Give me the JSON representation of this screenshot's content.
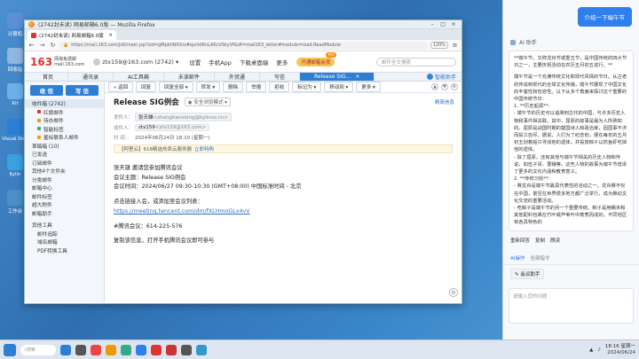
{
  "desktop": {
    "icons": [
      {
        "label": "计算机",
        "color": "#5b8fd8"
      },
      {
        "label": "回收站",
        "color": "#8fb5e0"
      },
      {
        "label": "Kit",
        "color": "#6cb0e8"
      },
      {
        "label": "Visual Studio",
        "color": "#2a7fd4"
      },
      {
        "label": "Kylin",
        "color": "#3aa0e0"
      },
      {
        "label": "工作台",
        "color": "#4a8fc8"
      }
    ]
  },
  "browser": {
    "window_title": "(2742封未读) 网易邮箱6.0版 — Mozilla Firefox",
    "tab_title": "(2742封未读) 网易邮箱6.0版",
    "url": "https://mail.163.com/js6/main.jsp?sid=gMpkhNIOns#qurtdRnLAKcVSkyVf&df=mail163_letter#module=read.ReadModule",
    "zoom": "120%"
  },
  "mail_header": {
    "logo_number": "163",
    "logo_brand": "网易免费邮",
    "logo_domain": "mail.163.com",
    "account": "ztx159@163.com (2742)",
    "links": [
      "设置",
      "手机App",
      "下载桌面端",
      "更多"
    ],
    "vip_label": "开通邮箱会员",
    "vip_badge": "特价",
    "search_placeholder": "邮件全文搜索"
  },
  "mail_tabs": {
    "items": [
      "首页",
      "通讯录",
      "AI工具箱",
      "未读邮件",
      "外贸通",
      "写信"
    ],
    "active": "Release SIG...",
    "helper": "智能助手"
  },
  "sidebar": {
    "receive": "收 信",
    "compose": "写 信",
    "items": [
      {
        "label": "收件箱 (2742)",
        "color": ""
      },
      {
        "label": "红旗邮件",
        "color": "#d33"
      },
      {
        "label": "待办邮件",
        "color": "#e90"
      },
      {
        "label": "智能标签",
        "color": "#3a8"
      },
      {
        "label": "星标联系人邮件",
        "color": "#f90"
      },
      {
        "label": "草稿箱 (10)",
        "color": ""
      },
      {
        "label": "已发送",
        "color": ""
      },
      {
        "label": "订阅邮件",
        "color": ""
      },
      {
        "label": "其他4个文件夹",
        "color": ""
      },
      {
        "label": "分类邮件",
        "color": ""
      },
      {
        "label": "邮箱中心",
        "color": ""
      },
      {
        "label": "邮件标签",
        "color": ""
      },
      {
        "label": "超大附件",
        "color": ""
      },
      {
        "label": "邮箱助手",
        "color": ""
      }
    ],
    "other_tools": "其他工具",
    "tools": [
      "邮件追踪",
      "域名邮箱",
      "PDF转换工具"
    ]
  },
  "toolbar": {
    "back": "« 返回",
    "buttons": [
      "回复",
      "回复全部 ▾",
      "转发 ▾",
      "删除",
      "举报",
      "拒收",
      "标记为 ▾",
      "移动到 ▾",
      "更多 ▾"
    ]
  },
  "email": {
    "subject": "Release SIG例会",
    "safe_mode": "安全浏览模式",
    "summary": "精简信息",
    "from_label": "发件人：",
    "from_name": "张天雄",
    "from_addr": "<zhangtianxiong@kylinos.cn>",
    "to_label": "收件人：",
    "to_name": "ztx159",
    "to_addr": "<ztx159@163.com>",
    "time_label": "时 间：",
    "time": "2024年06月24日 18:10 (星期一)",
    "notice": "【阿里云】618精选热卖云服务器",
    "notice_link": "立即特购",
    "body": {
      "line1": "张天雄 邀请您参加腾讯会议",
      "line2": "会议主题：Release SIG例会",
      "line3": "会议时间：2024/06/27 09:30-10:30 (GMT+08:00) 中国标准时间 - 北京",
      "line4": "点击链接入会，或添加至会议列表：",
      "link": "https://meeting.tencent.com/dm/fXLHmoGLx4vV",
      "line5": "#腾讯会议：614-225-576",
      "line6": "复制该信息，打开手机腾讯会议即可参与"
    }
  },
  "ai_panel": {
    "user_prompt": "介绍一下端午节",
    "assistant_name": "AI 助手",
    "paragraphs": [
      "**端午节，又称龙舟节或重五节，是中国传统的四大节日之一，主要庆祝活动在农历五月初五进行。**",
      "端午节是一个充满传统文化和现代风情的节日。从古老的传说到现代的全球文化传播，端午节展现了中国文化的丰富性和包容性。以下从多个角度来探讨这个重要的中国传统节日：",
      "1. **历史起源**：",
      "- 端午节的历史可以追溯到古代的中国，与许多历史人物和事件相关联。其中，屈原的故事是最为人所熟知的。屈原是战国时期的楚国诗人和政治家，因国事不济而投江自尽。据说，人们为了纪念他，便在每年的五月初五划着船只寻找他的遗体，并投放粽子以防鱼虾吃掉他的遗体。",
      "- 除了屈原，还有其他与端午节相关的历史人物和传说，如伍子胥、曹娥等。这些人物的故事为端午节增添了更多的文化内涵和教育意义。",
      "2. **传统习俗**：",
      "- 赛龙舟是端午节最具代表性的活动之一。龙舟赛不仅在中国，甚至在世界很多地方都广泛举行，成为推动文化交流的重要活动。",
      "- 吃粽子是端午节的另一个重要传统。粽子是用糯米和其他配料包裹在竹叶或芦苇叶中蒸煮而成的。不同地区有各具特色的"
    ],
    "actions": [
      "重新回答",
      "复制",
      "朗读"
    ],
    "tab_ai": "AI操作",
    "tab_all": "全部指令",
    "meeting_chip": "会议助手",
    "input_placeholder": "请输入您的问题"
  },
  "taskbar": {
    "search": "搜索",
    "time": "18:16 星期一",
    "date": "2024/06/24",
    "apps": [
      "#2d7fd3",
      "#555",
      "#e44",
      "#e90",
      "#3a8",
      "#2f80ed",
      "#d33",
      "#c33",
      "#555",
      "#39c"
    ]
  }
}
